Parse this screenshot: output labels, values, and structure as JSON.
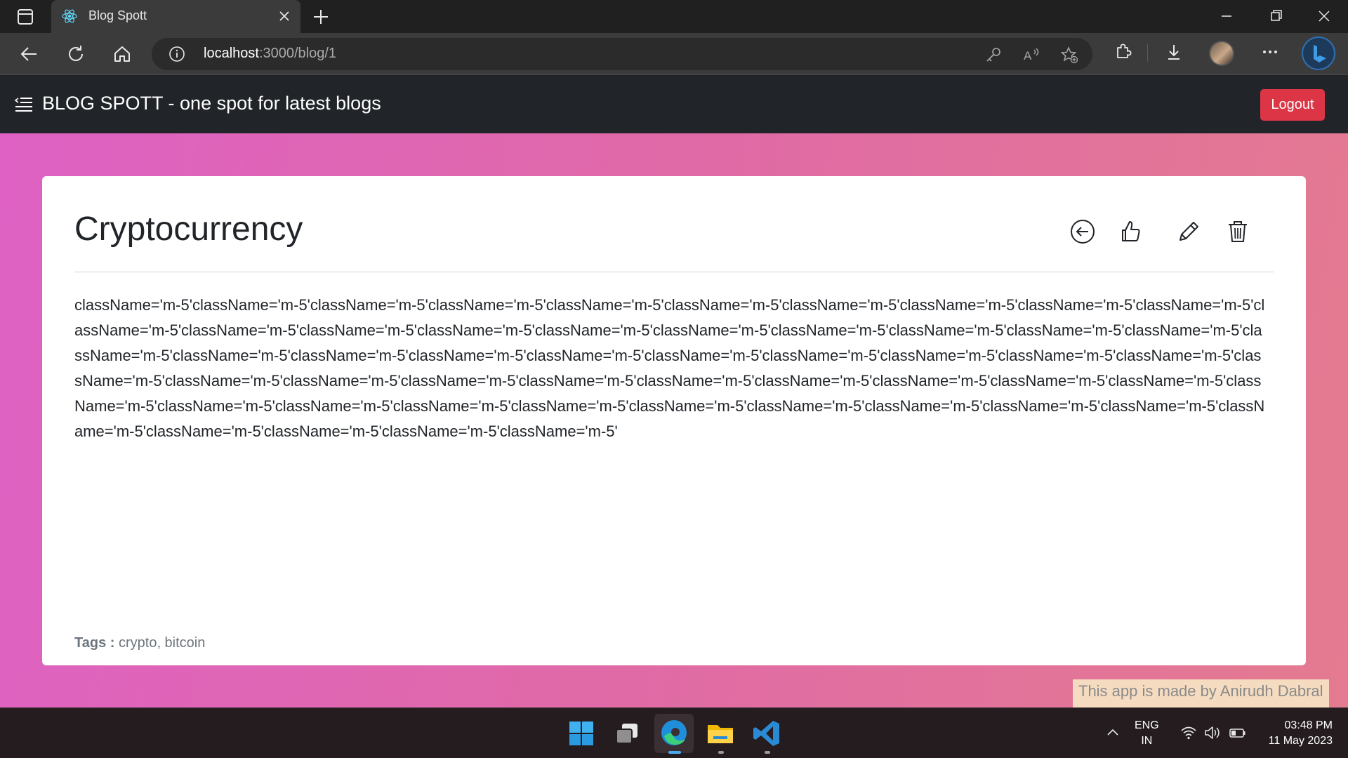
{
  "browser": {
    "tab_title": "Blog Spott",
    "address": {
      "host": "localhost",
      "rest": ":3000/blog/1"
    }
  },
  "site": {
    "brand": "BLOG SPOTT - one spot for latest blogs",
    "logout_label": "Logout"
  },
  "post": {
    "title": "Cryptocurrency",
    "body": "className='m-5'className='m-5'className='m-5'className='m-5'className='m-5'className='m-5'className='m-5'className='m-5'className='m-5'className='m-5'className='m-5'className='m-5'className='m-5'className='m-5'className='m-5'className='m-5'className='m-5'className='m-5'className='m-5'className='m-5'className='m-5'className='m-5'className='m-5'className='m-5'className='m-5'className='m-5'className='m-5'className='m-5'className='m-5'className='m-5'className='m-5'className='m-5'className='m-5'className='m-5'className='m-5'className='m-5'className='m-5'className='m-5'className='m-5'className='m-5'className='m-5'className='m-5'className='m-5'className='m-5'className='m-5'className='m-5'className='m-5'className='m-5'className='m-5'className='m-5'className='m-5'className='m-5'className='m-5'className='m-5'className='m-5'",
    "tags_label": "Tags :",
    "tags_value": "crypto, bitcoin",
    "actions": [
      "back-arrow-icon",
      "thumbs-up-icon",
      "pencil-icon",
      "trash-icon"
    ]
  },
  "credit": "This app is made by Anirudh Dabral",
  "taskbar": {
    "lang_line1": "ENG",
    "lang_line2": "IN",
    "time": "03:48 PM",
    "date": "11 May 2023"
  },
  "colors": {
    "header_bg": "#212529",
    "logout_bg": "#dc3545",
    "gradient_start": "#de61c4",
    "gradient_end": "#e47b90",
    "credit_bg": "#f5dcc0"
  }
}
